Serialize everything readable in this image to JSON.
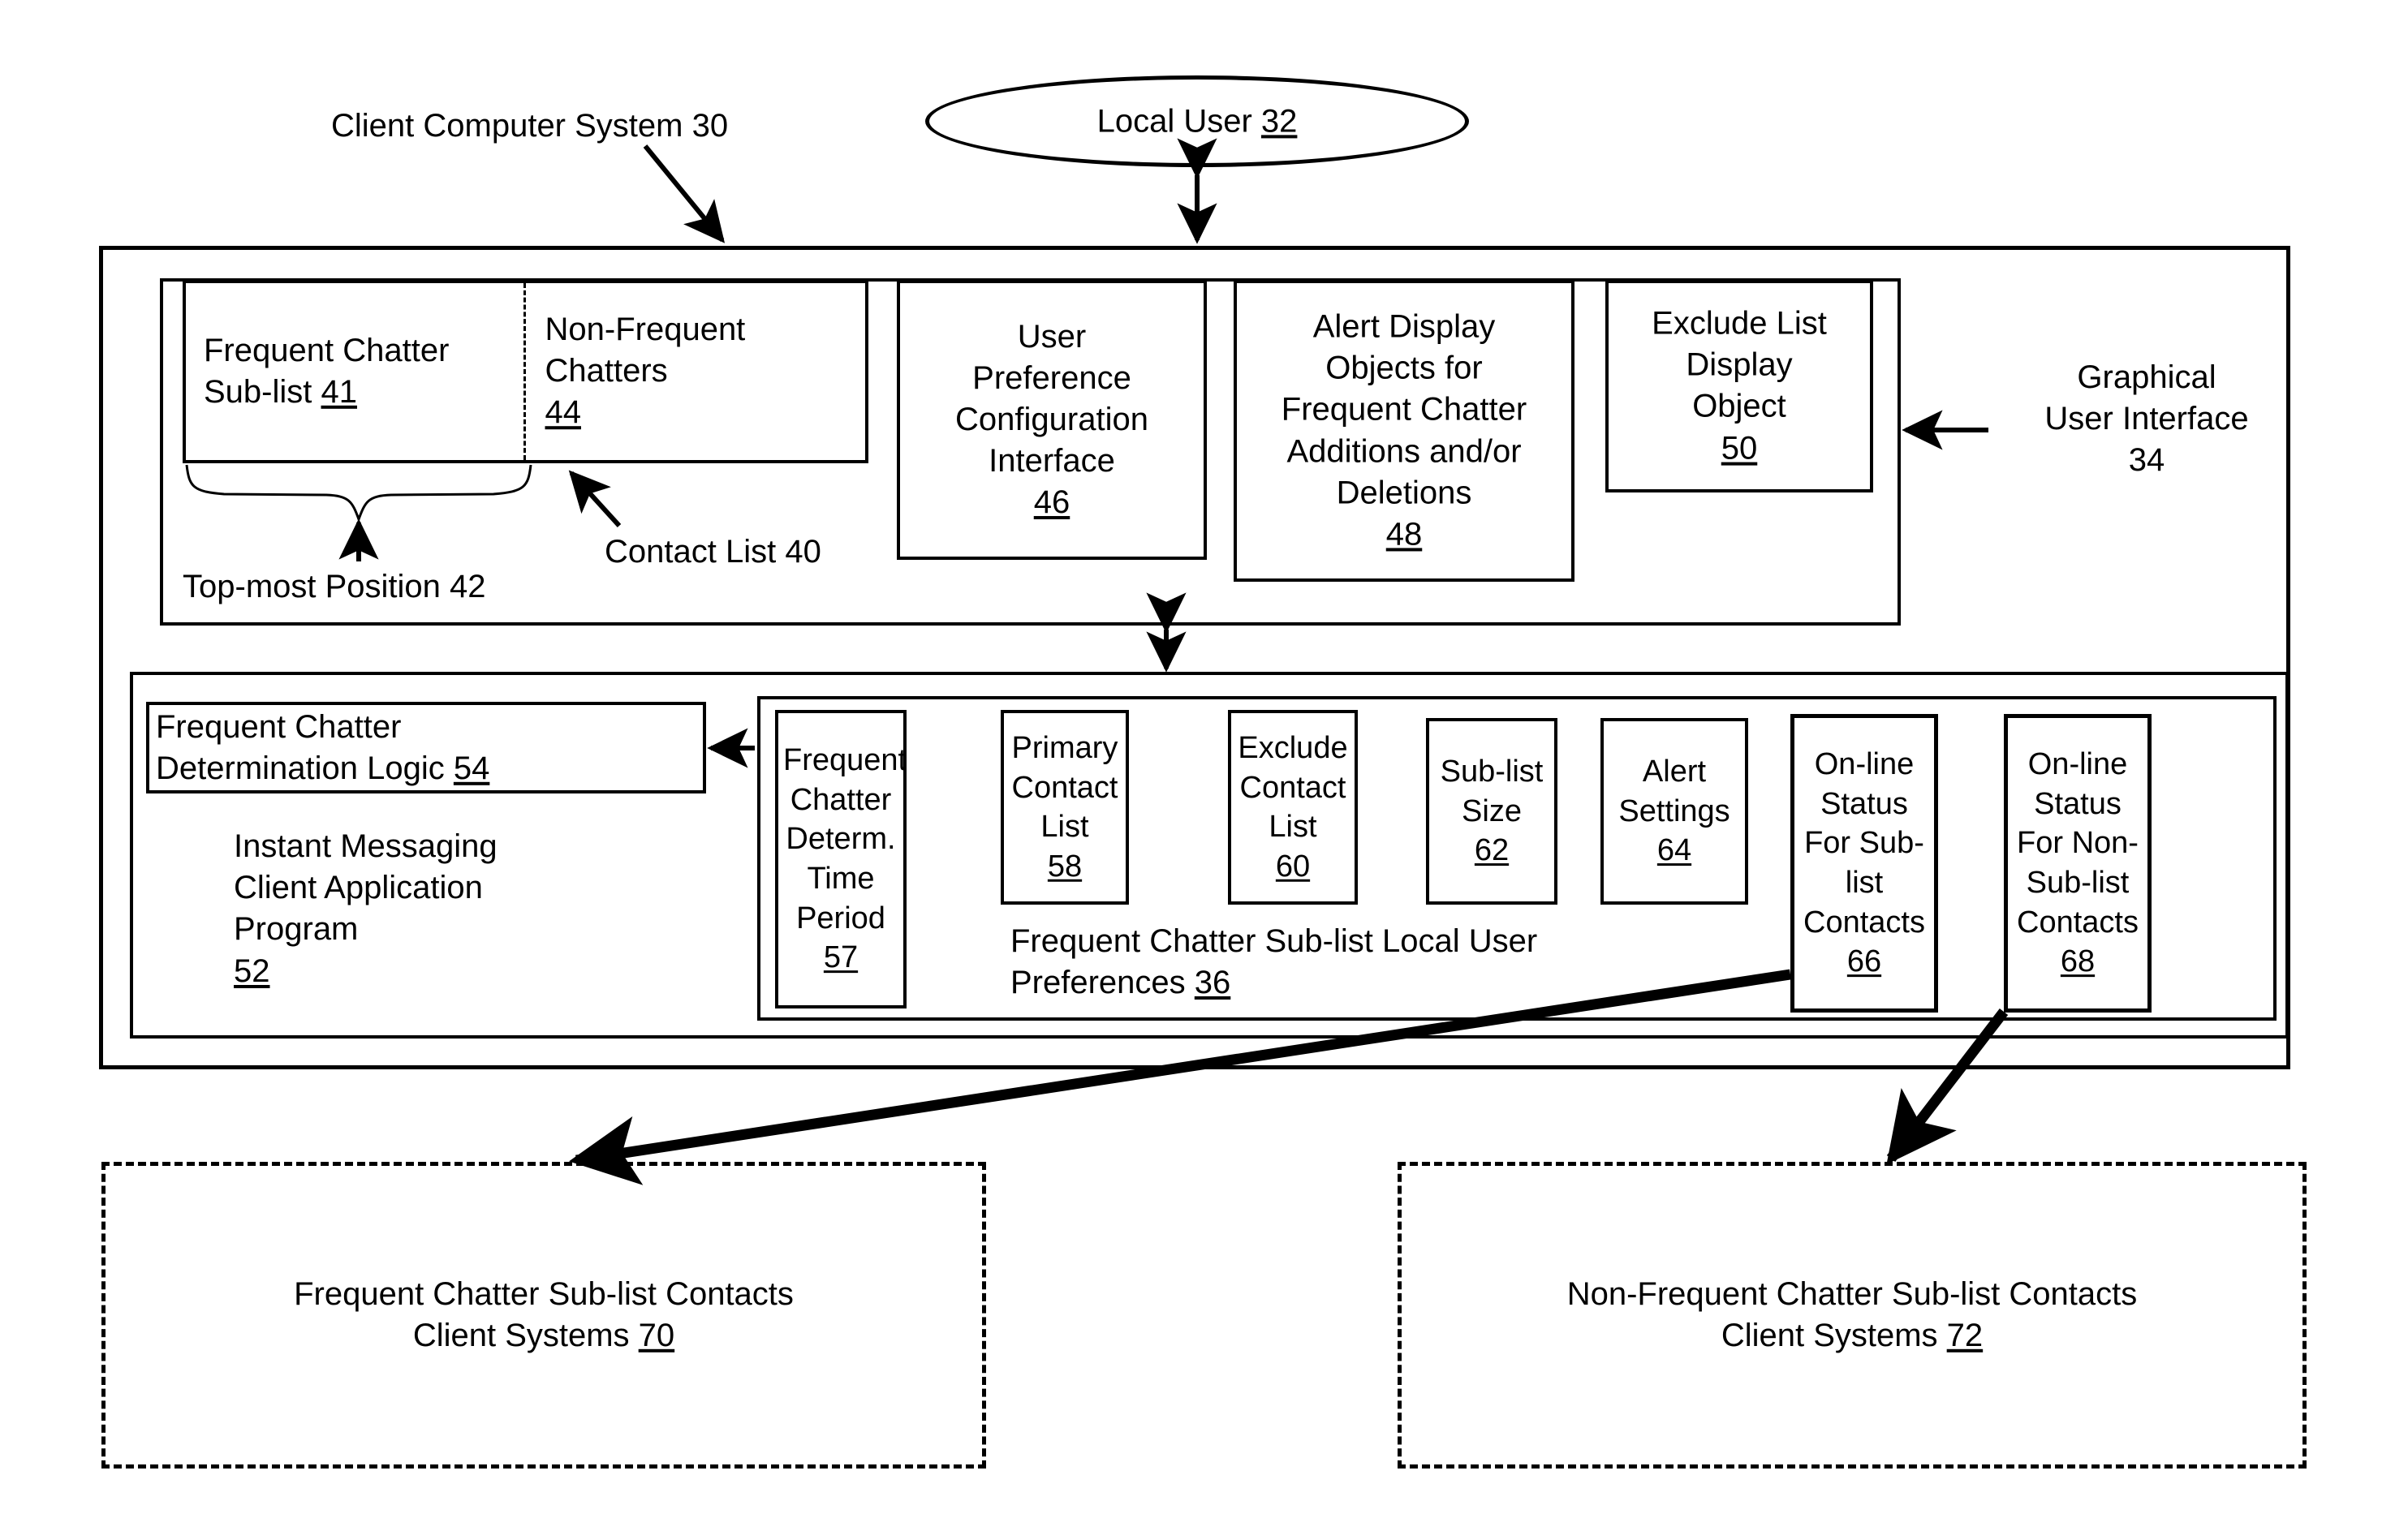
{
  "figure": {
    "title_label": "Client Computer System 30",
    "actor": {
      "name": "Local User",
      "ref": "32"
    },
    "gui_label_line1": "Graphical",
    "gui_label_line2": "User Interface",
    "gui_label_line3": "34"
  },
  "gui": {
    "contact_list": {
      "annotation": "Contact List 40",
      "brace_annotation": "Top-most Position 42",
      "left_cell": {
        "text": "Frequent Chatter\nSub-list ",
        "ref": "41"
      },
      "right_cell": {
        "text": "Non-Frequent\nChatters\n",
        "ref": "44"
      }
    },
    "boxes": [
      {
        "name": "user-preference-configuration-interface",
        "text": "User\nPreference\nConfiguration\nInterface\n",
        "ref": "46"
      },
      {
        "name": "alert-display-objects",
        "text": "Alert Display\nObjects for\nFrequent Chatter\nAdditions and/or\nDeletions\n",
        "ref": "48"
      },
      {
        "name": "exclude-list-display-object",
        "text": "Exclude List\nDisplay\nObject\n",
        "ref": "50"
      }
    ]
  },
  "im_client": {
    "determination_logic": {
      "text": "Frequent Chatter\nDetermination Logic ",
      "ref": "54"
    },
    "program_label": {
      "text": "Instant Messaging\nClient Application\nProgram\n",
      "ref": "52"
    },
    "preferences_caption": {
      "text": "Frequent Chatter Sub-list Local User\nPreferences ",
      "ref": "36"
    },
    "preference_boxes": [
      {
        "name": "frequent-chatter-determ-time-period",
        "text": "Frequent\nChatter\nDeterm.\nTime\nPeriod\n",
        "ref": "57"
      },
      {
        "name": "primary-contact-list",
        "text": "Primary\nContact\nList\n",
        "ref": "58"
      },
      {
        "name": "exclude-contact-list",
        "text": "Exclude\nContact\nList\n",
        "ref": "60"
      },
      {
        "name": "sub-list-size",
        "text": "Sub-list\nSize\n",
        "ref": "62"
      },
      {
        "name": "alert-settings",
        "text": "Alert\nSettings\n",
        "ref": "64"
      },
      {
        "name": "online-status-sublist-contacts",
        "text": "On-line\nStatus\nFor Sub-\nlist\nContacts\n",
        "ref": "66"
      },
      {
        "name": "online-status-non-sublist-contacts",
        "text": "On-line\nStatus\nFor Non-\nSub-list\nContacts\n",
        "ref": "68"
      }
    ]
  },
  "external_systems": [
    {
      "name": "frequent-chatter-sublist-contacts-client-systems",
      "text": "Frequent Chatter Sub-list Contacts\nClient Systems ",
      "ref": "70"
    },
    {
      "name": "non-frequent-chatter-sublist-contacts-client-systems",
      "text": "Non-Frequent Chatter Sub-list Contacts\nClient Systems ",
      "ref": "72"
    }
  ]
}
